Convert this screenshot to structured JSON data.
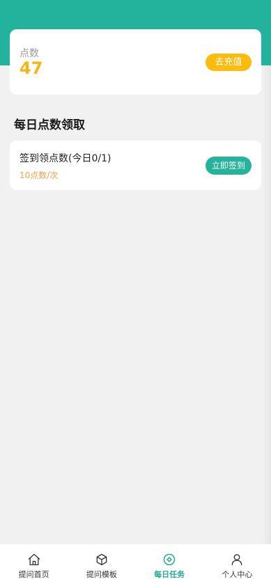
{
  "points": {
    "label": "点数",
    "value": "47",
    "recharge_label": "去充值"
  },
  "section": {
    "title": "每日点数领取"
  },
  "task": {
    "title": "签到领点数(今日0/1)",
    "reward": "10点数/次",
    "button_label": "立即签到"
  },
  "tabbar": {
    "items": [
      {
        "label": "提问首页",
        "icon": "home-icon"
      },
      {
        "label": "提问模板",
        "icon": "cube-icon"
      },
      {
        "label": "每日任务",
        "icon": "target-icon"
      },
      {
        "label": "个人中心",
        "icon": "user-icon"
      }
    ],
    "active_index": 2
  },
  "colors": {
    "primary": "#23b29b",
    "accent_yellow": "#fdbb0e",
    "reward_orange": "#f0a14a",
    "tab_active": "#22a894"
  }
}
